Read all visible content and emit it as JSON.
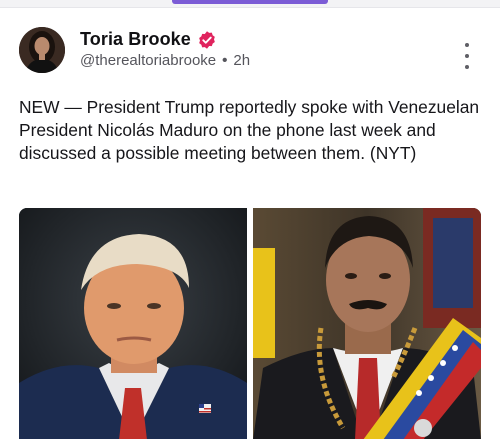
{
  "post": {
    "author": {
      "display_name": "Toria Brooke",
      "verified": true,
      "verified_icon": "verified-badge-icon",
      "handle": "@therealtoriabrooke",
      "separator": "•",
      "time_ago": "2h",
      "avatar_icon": "avatar-photo"
    },
    "menu_icon": "more-vertical-icon",
    "text": "NEW — President Trump reportedly spoke with Venezuelan President Nicolás Maduro on the phone last week and discussed a possible meeting between them. (NYT)",
    "media": [
      {
        "icon": "photo-trump-portrait"
      },
      {
        "icon": "photo-maduro-portrait"
      }
    ]
  },
  "colors": {
    "accent": "#7c5cd6",
    "verified_badge": "#e0245e",
    "text_primary": "#111114",
    "text_secondary": "#55555c"
  }
}
